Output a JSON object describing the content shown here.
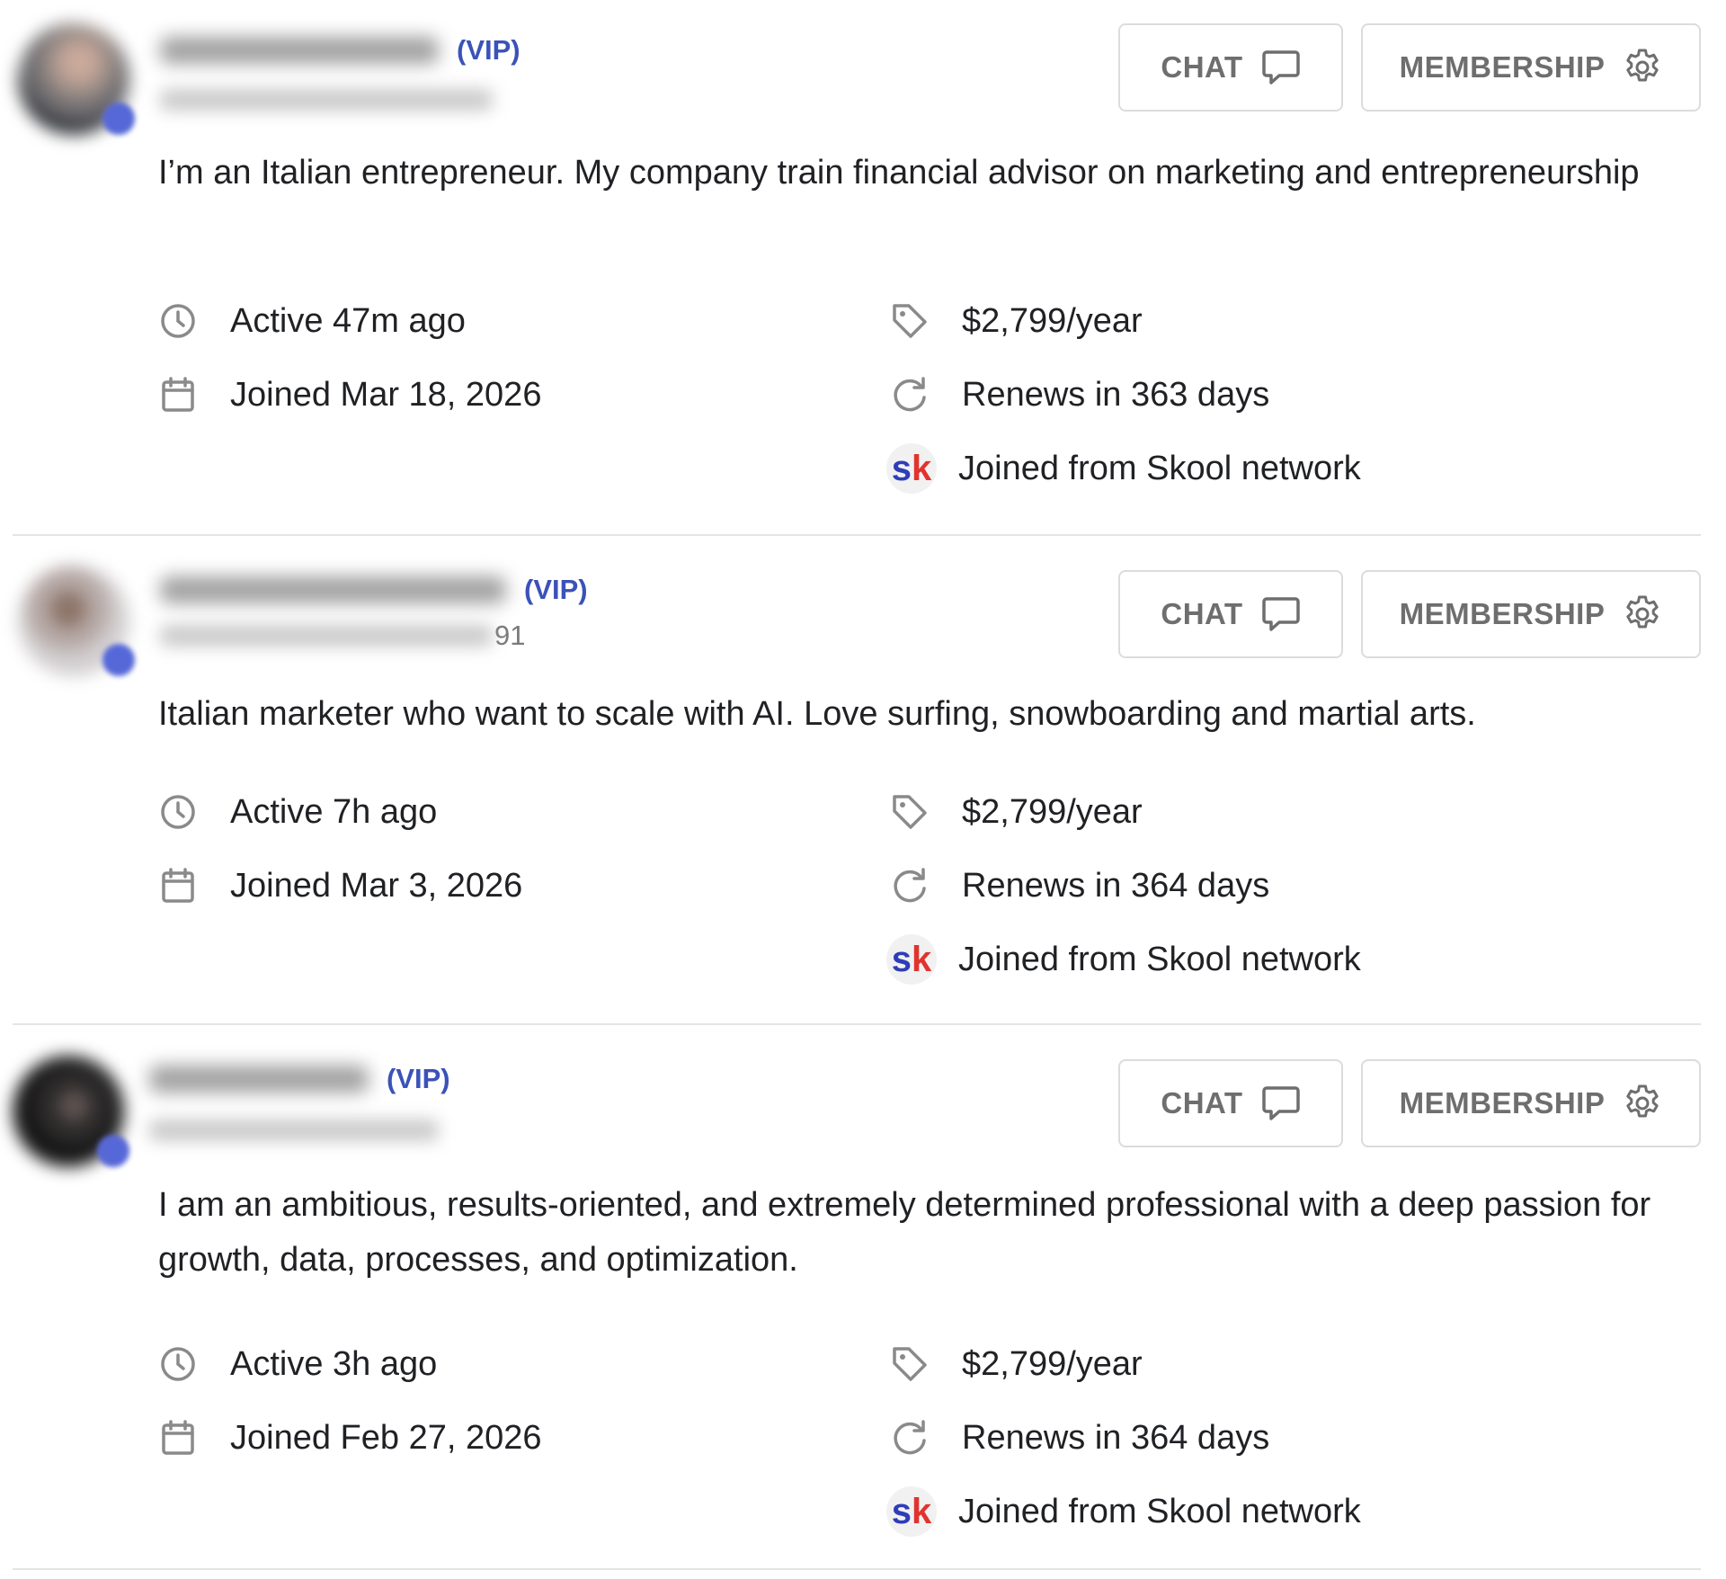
{
  "members": [
    {
      "vip_label": "(VIP)",
      "handle_tail": "",
      "bio": "I’m an Italian entrepreneur. My company train financial advisor on marketing and entrepreneurship",
      "active": "Active 47m ago",
      "joined": "Joined Mar 18, 2026",
      "price": "$2,799/year",
      "renews": "Renews in 363 days",
      "source": "Joined from Skool network",
      "chat_label": "CHAT",
      "membership_label": "MEMBERSHIP"
    },
    {
      "vip_label": "(VIP)",
      "handle_tail": "91",
      "bio": "Italian marketer who want to scale with AI. Love surfing, snowboarding and martial arts.",
      "active": "Active 7h ago",
      "joined": "Joined Mar 3, 2026",
      "price": "$2,799/year",
      "renews": "Renews in 364 days",
      "source": "Joined from Skool network",
      "chat_label": "CHAT",
      "membership_label": "MEMBERSHIP"
    },
    {
      "vip_label": "(VIP)",
      "handle_tail": "",
      "bio": "I am an ambitious, results-oriented, and extremely determined professional with a deep passion for growth, data, processes, and optimization.",
      "active": "Active 3h ago",
      "joined": "Joined Feb 27, 2026",
      "price": "$2,799/year",
      "renews": "Renews in 364 days",
      "source": "Joined from Skool network",
      "chat_label": "CHAT",
      "membership_label": "MEMBERSHIP"
    }
  ],
  "network_badge": {
    "s": "s",
    "k": "k"
  },
  "icons": {
    "active": "clock-icon",
    "joined": "calendar-icon",
    "price": "price-tag-icon",
    "renews": "refresh-icon",
    "source": "skool-logo",
    "chat": "chat-bubble-icon",
    "membership": "gear-icon"
  },
  "colors": {
    "vip": "#3b52b8",
    "button_text": "#6e6e6e",
    "button_border": "#dcdcdc",
    "logo_s": "#2e3db8",
    "logo_k": "#e1332e",
    "online_dot": "#5668d8"
  }
}
